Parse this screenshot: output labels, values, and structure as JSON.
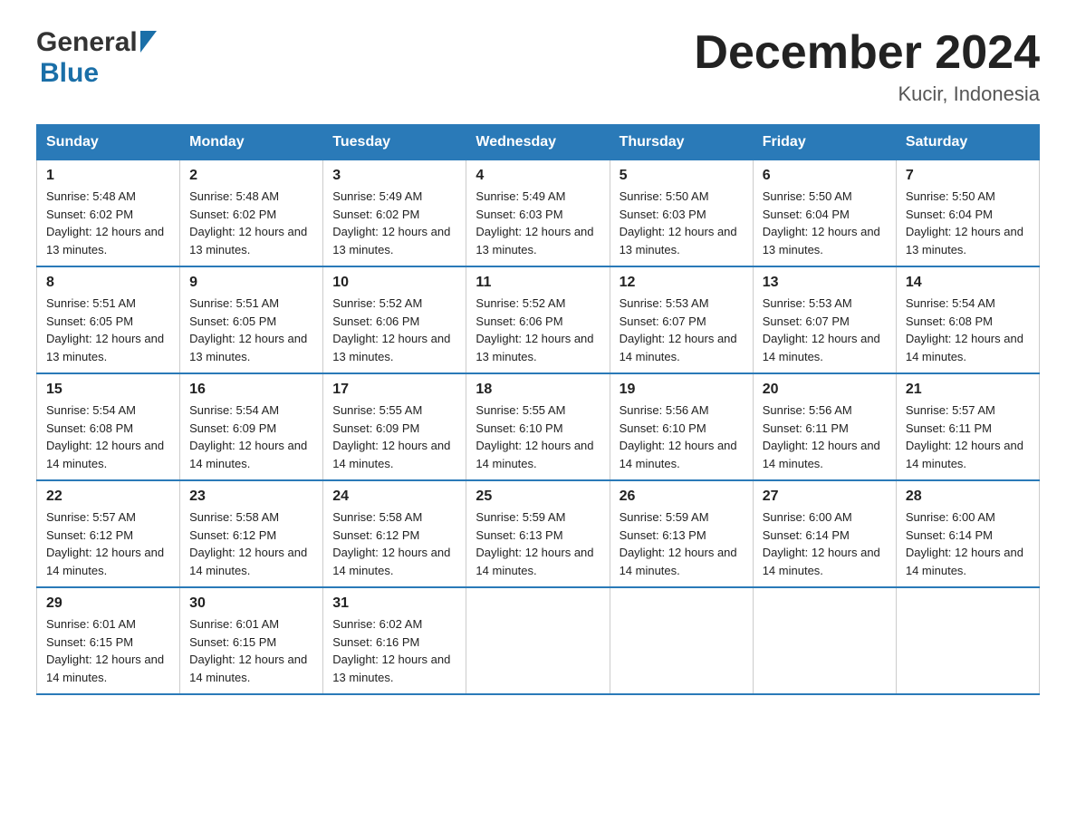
{
  "header": {
    "title": "December 2024",
    "location": "Kucir, Indonesia",
    "logo_general": "General",
    "logo_blue": "Blue"
  },
  "calendar": {
    "days_of_week": [
      "Sunday",
      "Monday",
      "Tuesday",
      "Wednesday",
      "Thursday",
      "Friday",
      "Saturday"
    ],
    "weeks": [
      [
        {
          "day": "1",
          "sunrise": "Sunrise: 5:48 AM",
          "sunset": "Sunset: 6:02 PM",
          "daylight": "Daylight: 12 hours and 13 minutes."
        },
        {
          "day": "2",
          "sunrise": "Sunrise: 5:48 AM",
          "sunset": "Sunset: 6:02 PM",
          "daylight": "Daylight: 12 hours and 13 minutes."
        },
        {
          "day": "3",
          "sunrise": "Sunrise: 5:49 AM",
          "sunset": "Sunset: 6:02 PM",
          "daylight": "Daylight: 12 hours and 13 minutes."
        },
        {
          "day": "4",
          "sunrise": "Sunrise: 5:49 AM",
          "sunset": "Sunset: 6:03 PM",
          "daylight": "Daylight: 12 hours and 13 minutes."
        },
        {
          "day": "5",
          "sunrise": "Sunrise: 5:50 AM",
          "sunset": "Sunset: 6:03 PM",
          "daylight": "Daylight: 12 hours and 13 minutes."
        },
        {
          "day": "6",
          "sunrise": "Sunrise: 5:50 AM",
          "sunset": "Sunset: 6:04 PM",
          "daylight": "Daylight: 12 hours and 13 minutes."
        },
        {
          "day": "7",
          "sunrise": "Sunrise: 5:50 AM",
          "sunset": "Sunset: 6:04 PM",
          "daylight": "Daylight: 12 hours and 13 minutes."
        }
      ],
      [
        {
          "day": "8",
          "sunrise": "Sunrise: 5:51 AM",
          "sunset": "Sunset: 6:05 PM",
          "daylight": "Daylight: 12 hours and 13 minutes."
        },
        {
          "day": "9",
          "sunrise": "Sunrise: 5:51 AM",
          "sunset": "Sunset: 6:05 PM",
          "daylight": "Daylight: 12 hours and 13 minutes."
        },
        {
          "day": "10",
          "sunrise": "Sunrise: 5:52 AM",
          "sunset": "Sunset: 6:06 PM",
          "daylight": "Daylight: 12 hours and 13 minutes."
        },
        {
          "day": "11",
          "sunrise": "Sunrise: 5:52 AM",
          "sunset": "Sunset: 6:06 PM",
          "daylight": "Daylight: 12 hours and 13 minutes."
        },
        {
          "day": "12",
          "sunrise": "Sunrise: 5:53 AM",
          "sunset": "Sunset: 6:07 PM",
          "daylight": "Daylight: 12 hours and 14 minutes."
        },
        {
          "day": "13",
          "sunrise": "Sunrise: 5:53 AM",
          "sunset": "Sunset: 6:07 PM",
          "daylight": "Daylight: 12 hours and 14 minutes."
        },
        {
          "day": "14",
          "sunrise": "Sunrise: 5:54 AM",
          "sunset": "Sunset: 6:08 PM",
          "daylight": "Daylight: 12 hours and 14 minutes."
        }
      ],
      [
        {
          "day": "15",
          "sunrise": "Sunrise: 5:54 AM",
          "sunset": "Sunset: 6:08 PM",
          "daylight": "Daylight: 12 hours and 14 minutes."
        },
        {
          "day": "16",
          "sunrise": "Sunrise: 5:54 AM",
          "sunset": "Sunset: 6:09 PM",
          "daylight": "Daylight: 12 hours and 14 minutes."
        },
        {
          "day": "17",
          "sunrise": "Sunrise: 5:55 AM",
          "sunset": "Sunset: 6:09 PM",
          "daylight": "Daylight: 12 hours and 14 minutes."
        },
        {
          "day": "18",
          "sunrise": "Sunrise: 5:55 AM",
          "sunset": "Sunset: 6:10 PM",
          "daylight": "Daylight: 12 hours and 14 minutes."
        },
        {
          "day": "19",
          "sunrise": "Sunrise: 5:56 AM",
          "sunset": "Sunset: 6:10 PM",
          "daylight": "Daylight: 12 hours and 14 minutes."
        },
        {
          "day": "20",
          "sunrise": "Sunrise: 5:56 AM",
          "sunset": "Sunset: 6:11 PM",
          "daylight": "Daylight: 12 hours and 14 minutes."
        },
        {
          "day": "21",
          "sunrise": "Sunrise: 5:57 AM",
          "sunset": "Sunset: 6:11 PM",
          "daylight": "Daylight: 12 hours and 14 minutes."
        }
      ],
      [
        {
          "day": "22",
          "sunrise": "Sunrise: 5:57 AM",
          "sunset": "Sunset: 6:12 PM",
          "daylight": "Daylight: 12 hours and 14 minutes."
        },
        {
          "day": "23",
          "sunrise": "Sunrise: 5:58 AM",
          "sunset": "Sunset: 6:12 PM",
          "daylight": "Daylight: 12 hours and 14 minutes."
        },
        {
          "day": "24",
          "sunrise": "Sunrise: 5:58 AM",
          "sunset": "Sunset: 6:12 PM",
          "daylight": "Daylight: 12 hours and 14 minutes."
        },
        {
          "day": "25",
          "sunrise": "Sunrise: 5:59 AM",
          "sunset": "Sunset: 6:13 PM",
          "daylight": "Daylight: 12 hours and 14 minutes."
        },
        {
          "day": "26",
          "sunrise": "Sunrise: 5:59 AM",
          "sunset": "Sunset: 6:13 PM",
          "daylight": "Daylight: 12 hours and 14 minutes."
        },
        {
          "day": "27",
          "sunrise": "Sunrise: 6:00 AM",
          "sunset": "Sunset: 6:14 PM",
          "daylight": "Daylight: 12 hours and 14 minutes."
        },
        {
          "day": "28",
          "sunrise": "Sunrise: 6:00 AM",
          "sunset": "Sunset: 6:14 PM",
          "daylight": "Daylight: 12 hours and 14 minutes."
        }
      ],
      [
        {
          "day": "29",
          "sunrise": "Sunrise: 6:01 AM",
          "sunset": "Sunset: 6:15 PM",
          "daylight": "Daylight: 12 hours and 14 minutes."
        },
        {
          "day": "30",
          "sunrise": "Sunrise: 6:01 AM",
          "sunset": "Sunset: 6:15 PM",
          "daylight": "Daylight: 12 hours and 14 minutes."
        },
        {
          "day": "31",
          "sunrise": "Sunrise: 6:02 AM",
          "sunset": "Sunset: 6:16 PM",
          "daylight": "Daylight: 12 hours and 13 minutes."
        },
        {
          "day": "",
          "sunrise": "",
          "sunset": "",
          "daylight": ""
        },
        {
          "day": "",
          "sunrise": "",
          "sunset": "",
          "daylight": ""
        },
        {
          "day": "",
          "sunrise": "",
          "sunset": "",
          "daylight": ""
        },
        {
          "day": "",
          "sunrise": "",
          "sunset": "",
          "daylight": ""
        }
      ]
    ]
  }
}
